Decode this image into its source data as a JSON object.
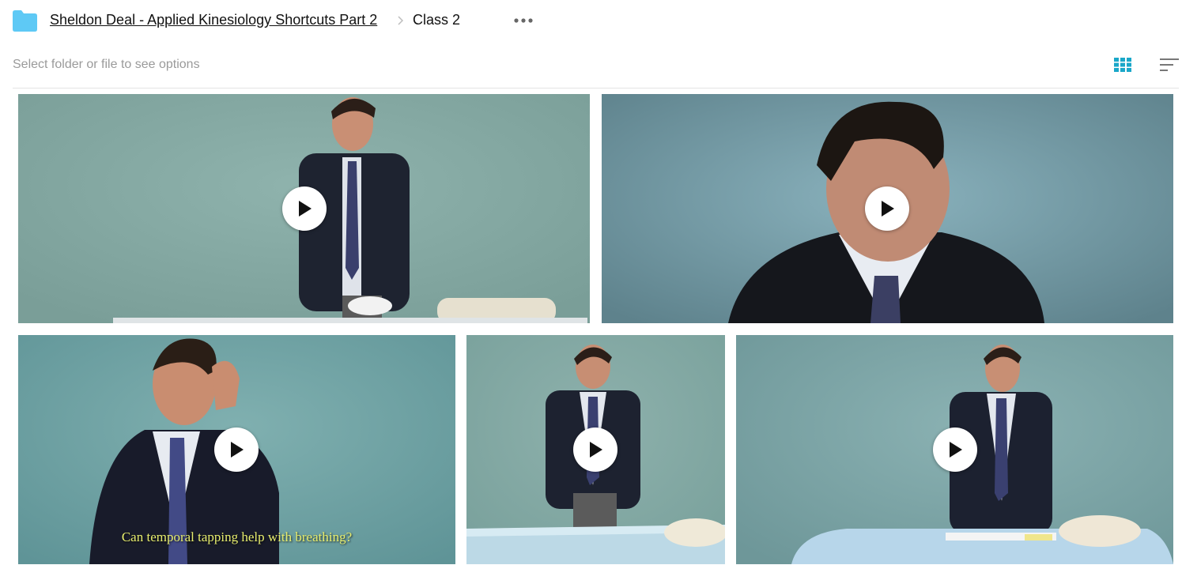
{
  "breadcrumb": {
    "root": "Sheldon Deal - Applied Kinesiology Shortcuts Part 2",
    "current": "Class 2"
  },
  "toolbar": {
    "hint": "Select folder or file to see options",
    "grid_icon": "grid-view-icon",
    "sort_icon": "sort-icon",
    "more_icon": "more-horizontal-icon"
  },
  "colors": {
    "folder": "#5ec9f5",
    "accent": "#1aa7c9"
  },
  "videos": [
    {
      "caption": ""
    },
    {
      "caption": ""
    },
    {
      "caption": "Can temporal tapping help with breathing?"
    },
    {
      "caption": ""
    },
    {
      "caption": ""
    }
  ]
}
